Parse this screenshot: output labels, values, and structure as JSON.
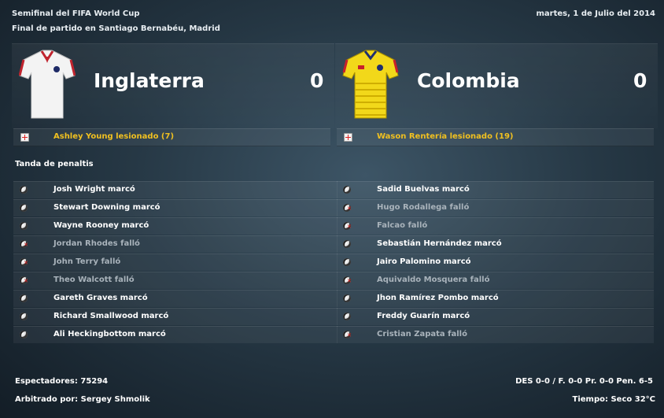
{
  "header": {
    "competition": "Semifinal del FIFA World Cup",
    "venue": "Final de partido en Santiago Bernabéu, Madrid",
    "date": "martes, 1 de Julio del 2014"
  },
  "home": {
    "name": "Inglaterra",
    "score": "0",
    "shirt_colors": {
      "body": "#f2f2f2",
      "trim": "#c0242e"
    },
    "injury": "Ashley Young lesionado (7)"
  },
  "away": {
    "name": "Colombia",
    "score": "0",
    "shirt_colors": {
      "body": "#f2d81a",
      "stripe": "#d4b400"
    },
    "injury": "Wason Rentería lesionado (19)"
  },
  "shootout": {
    "title": "Tanda de penaltis",
    "home": [
      {
        "text": "Josh Wright marcó",
        "scored": true
      },
      {
        "text": "Stewart Downing marcó",
        "scored": true
      },
      {
        "text": "Wayne Rooney marcó",
        "scored": true
      },
      {
        "text": "Jordan Rhodes falló",
        "scored": false
      },
      {
        "text": "John Terry falló",
        "scored": false
      },
      {
        "text": "Theo Walcott falló",
        "scored": false
      },
      {
        "text": "Gareth Graves marcó",
        "scored": true
      },
      {
        "text": "Richard Smallwood marcó",
        "scored": true
      },
      {
        "text": "Ali Heckingbottom marcó",
        "scored": true
      }
    ],
    "away": [
      {
        "text": "Sadid Buelvas marcó",
        "scored": true
      },
      {
        "text": "Hugo Rodallega falló",
        "scored": false
      },
      {
        "text": "Falcao falló",
        "scored": false
      },
      {
        "text": "Sebastián Hernández marcó",
        "scored": true
      },
      {
        "text": "Jairo Palomino marcó",
        "scored": true
      },
      {
        "text": "Aquivaldo Mosquera falló",
        "scored": false
      },
      {
        "text": "Jhon Ramírez Pombo marcó",
        "scored": true
      },
      {
        "text": "Freddy Guarín marcó",
        "scored": true
      },
      {
        "text": "Cristian Zapata falló",
        "scored": false
      }
    ]
  },
  "footer": {
    "attendance": "Espectadores: 75294",
    "referee": "Arbitrado por: Sergey Shmolik",
    "score_summary": "DES 0-0 / F. 0-0 Pr. 0-0 Pen. 6-5",
    "weather": "Tiempo: Seco 32°C"
  }
}
